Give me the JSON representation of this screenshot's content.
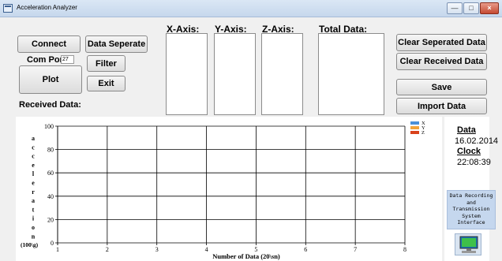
{
  "window": {
    "title": "Acceleration Analyzer",
    "controls": {
      "minimize": "—",
      "maximize": "□",
      "close": "×"
    }
  },
  "left_panel": {
    "connect_label": "Connect",
    "com_port_label": "Com Port",
    "com_port_value": "27",
    "plot_label": "Plot",
    "data_separate_label": "Data Seperate",
    "filter_label": "Filter",
    "exit_label": "Exit",
    "received_data_label": "Received Data:"
  },
  "lists": {
    "x_axis": "X-Axis:",
    "y_axis": "Y-Axis:",
    "z_axis": "Z-Axis:",
    "total": "Total Data:"
  },
  "right_buttons": {
    "clear_separated": "Clear Seperated Data",
    "clear_received": "Clear Received Data",
    "save": "Save",
    "import": "Import Data"
  },
  "info": {
    "date_label": "Data",
    "date_value": "16.02.2014",
    "clock_label": "Clock",
    "clock_value": "22:08:39",
    "system_lines": [
      "Data Recording",
      "and",
      "Transmission",
      "System",
      "Interface"
    ]
  },
  "chart_data": {
    "type": "line",
    "x_ticks": [
      1,
      2,
      3,
      4,
      5,
      6,
      7,
      8
    ],
    "y_ticks": [
      0,
      20,
      40,
      60,
      80,
      100
    ],
    "xlim": [
      1,
      8
    ],
    "ylim": [
      0,
      100
    ],
    "grid": true,
    "xlabel": "Number of Data (20\\sn)",
    "ylabel_letters": [
      "a",
      "c",
      "c",
      "e",
      "l",
      "e",
      "r",
      "a",
      "t",
      "i",
      "o",
      "n"
    ],
    "ylabel_unit": "(100\\g)",
    "legend_position": "top-right",
    "series": [
      {
        "name": "X",
        "color": "#4a90d9",
        "values": []
      },
      {
        "name": "Y",
        "color": "#f2a33a",
        "values": []
      },
      {
        "name": "Z",
        "color": "#d9421b",
        "values": []
      }
    ]
  }
}
